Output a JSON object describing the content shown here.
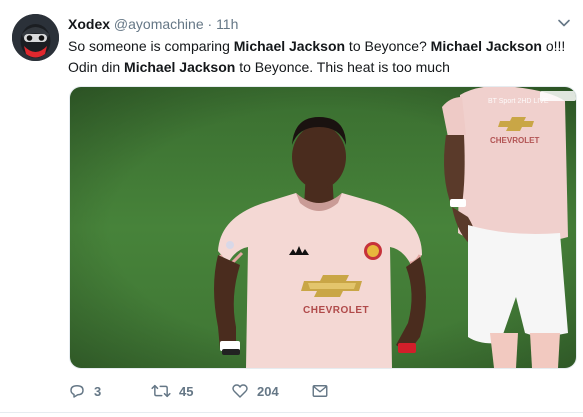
{
  "tweet": {
    "display_name": "Xodex",
    "handle": "@ayomachine",
    "separator": "·",
    "time": "11h",
    "text": {
      "p1": "So someone is comparing ",
      "p2": "Michael Jackson",
      "p3": " to Beyonce?  ",
      "p4": "Michael Jackson",
      "p5": " o!!!",
      "p6": "Odin din ",
      "p7": "Michael Jackson",
      "p8": " to Beyonce. This heat is too much"
    },
    "media": {
      "broadcaster": "BT Sport 2HD LIVE",
      "sponsor": "CHEVROLET",
      "background_sponsor": "CHEVROLET"
    },
    "actions": {
      "reply_count": "3",
      "retweet_count": "45",
      "like_count": "204"
    }
  },
  "colors": {
    "text": "#14171a",
    "secondary": "#657786",
    "pitch": "#3e7a33",
    "kit": "#f2d3d0"
  }
}
